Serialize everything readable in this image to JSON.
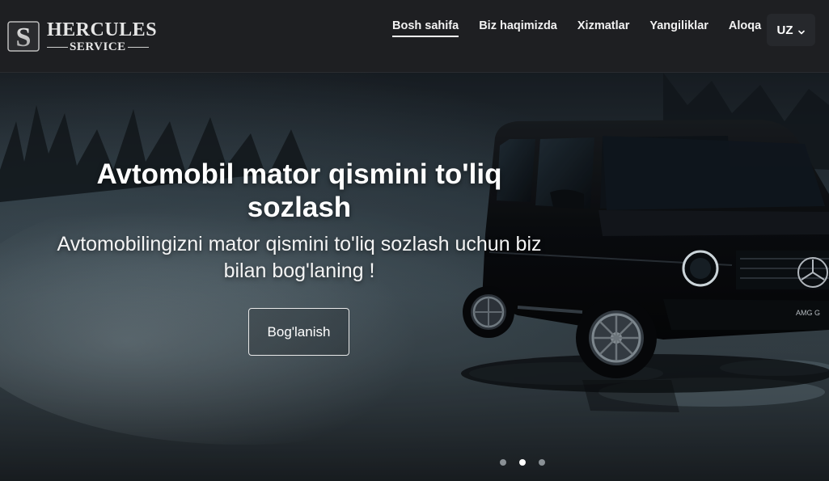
{
  "brand": {
    "name": "HERCULES",
    "sub": "SERVICE",
    "mark_letter": "S"
  },
  "nav": {
    "items": [
      {
        "label": "Bosh sahifa",
        "active": true
      },
      {
        "label": "Biz haqimizda",
        "active": false
      },
      {
        "label": "Xizmatlar",
        "active": false
      },
      {
        "label": "Yangiliklar",
        "active": false
      },
      {
        "label": "Aloqa",
        "active": false
      }
    ],
    "language": "UZ",
    "language_icon": "chevron-down-icon"
  },
  "hero": {
    "title": "Avtomobil mator qismini to'liq sozlash",
    "subtitle": "Avtomobilingizni mator qismini to'liq sozlash uchun biz bilan bog'laning !",
    "button_label": "Bog'lanish",
    "car_badge": "AMG G",
    "slides": {
      "count": 3,
      "active_index": 1
    }
  },
  "colors": {
    "header_bg": "#1e1f22",
    "accent": "#ffffff",
    "dot_inactive": "#8a9196"
  }
}
